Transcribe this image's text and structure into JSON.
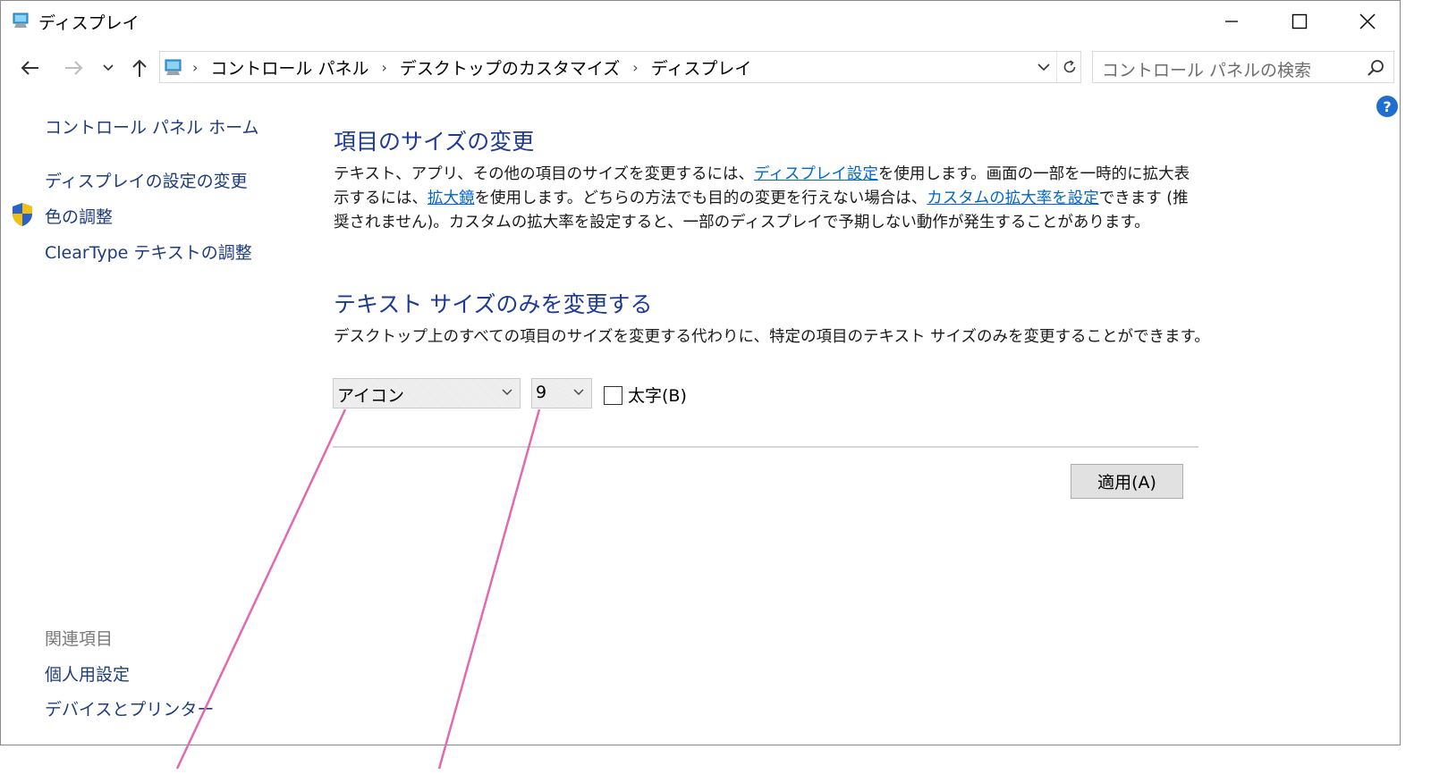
{
  "window": {
    "title": "ディスプレイ"
  },
  "address": {
    "breadcrumbs": [
      "コントロール パネル",
      "デスクトップのカスタマイズ",
      "ディスプレイ"
    ],
    "search_placeholder": "コントロール パネルの検索"
  },
  "sidebar": {
    "home": "コントロール パネル ホーム",
    "display_settings": "ディスプレイの設定の変更",
    "color": "色の調整",
    "cleartype": "ClearType テキストの調整",
    "related_heading": "関連項目",
    "personalize": "個人用設定",
    "devices": "デバイスとプリンター"
  },
  "main": {
    "resize_title": "項目のサイズの変更",
    "resize_p1": "テキスト、アプリ、その他の項目のサイズを変更するには、",
    "resize_link1": "ディスプレイ設定",
    "resize_p2": "を使用します。画面の一部を一時的に拡大表示するには、",
    "resize_link2": "拡大鏡",
    "resize_p3": "を使用します。どちらの方法でも目的の変更を行えない場合は、",
    "resize_link3": "カスタムの拡大率を設定",
    "resize_p4": "できます (推奨されません)。カスタムの拡大率を設定すると、一部のディスプレイで予期しない動作が発生することがあります。",
    "text_title": "テキスト サイズのみを変更する",
    "text_desc": "デスクトップ上のすべての項目のサイズを変更する代わりに、特定の項目のテキスト サイズのみを変更することができます。",
    "item_select": "アイコン",
    "size_select": "9",
    "bold_label": "太字(B)",
    "bold_checked": false,
    "apply": "適用(A)"
  },
  "colors": {
    "link": "#0066cc",
    "heading": "#1e3a96",
    "annotation": "#e06ab0"
  }
}
